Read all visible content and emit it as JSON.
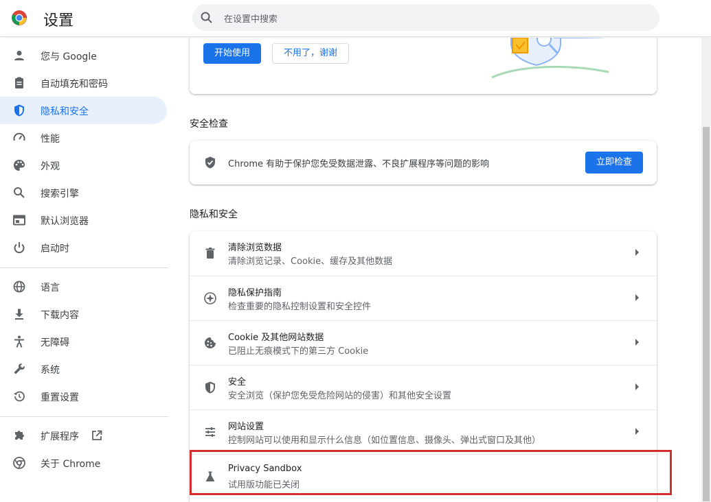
{
  "header": {
    "title": "设置",
    "search_placeholder": "在设置中搜索"
  },
  "sidebar": {
    "items": [
      {
        "label": "您与 Google",
        "icon": "person-icon"
      },
      {
        "label": "自动填充和密码",
        "icon": "clipboard-icon"
      },
      {
        "label": "隐私和安全",
        "icon": "shield-icon",
        "active": true
      },
      {
        "label": "性能",
        "icon": "speedometer-icon"
      },
      {
        "label": "外观",
        "icon": "palette-icon"
      },
      {
        "label": "搜索引擎",
        "icon": "search-icon"
      },
      {
        "label": "默认浏览器",
        "icon": "browser-icon"
      },
      {
        "label": "启动时",
        "icon": "power-icon"
      },
      {
        "label": "语言",
        "icon": "globe-icon"
      },
      {
        "label": "下载内容",
        "icon": "download-icon"
      },
      {
        "label": "无障碍",
        "icon": "accessibility-icon"
      },
      {
        "label": "系统",
        "icon": "wrench-icon"
      },
      {
        "label": "重置设置",
        "icon": "history-icon"
      },
      {
        "label": "扩展程序",
        "icon": "puzzle-icon"
      },
      {
        "label": "关于 Chrome",
        "icon": "chrome-icon"
      }
    ]
  },
  "promo": {
    "start_label": "开始使用",
    "dismiss_label": "不用了，谢谢"
  },
  "safety_check": {
    "section_title": "安全检查",
    "description": "Chrome 有助于保护您免受数据泄露、不良扩展程序等问题的影响",
    "button_label": "立即检查"
  },
  "privacy": {
    "section_title": "隐私和安全",
    "rows": [
      {
        "title": "清除浏览数据",
        "subtitle": "清除浏览记录、Cookie、缓存及其他数据",
        "icon": "trash-icon"
      },
      {
        "title": "隐私保护指南",
        "subtitle": "检查重要的隐私控制设置和安全控件",
        "icon": "compass-icon"
      },
      {
        "title": "Cookie 及其他网站数据",
        "subtitle": "已阻止无痕模式下的第三方 Cookie",
        "icon": "cookie-icon"
      },
      {
        "title": "安全",
        "subtitle": "安全浏览（保护您免受危险网站的侵害）和其他安全设置",
        "icon": "shield-icon"
      },
      {
        "title": "网站设置",
        "subtitle": "控制网站可以使用和显示什么信息（如位置信息、摄像头、弹出式窗口及其他）",
        "icon": "sliders-icon"
      },
      {
        "title": "Privacy Sandbox",
        "subtitle": "试用版功能已关闭",
        "icon": "flask-icon"
      }
    ]
  },
  "colors": {
    "accent": "#1a73e8",
    "active_bg": "#e8f0fe",
    "highlight": "#d32f2f"
  }
}
